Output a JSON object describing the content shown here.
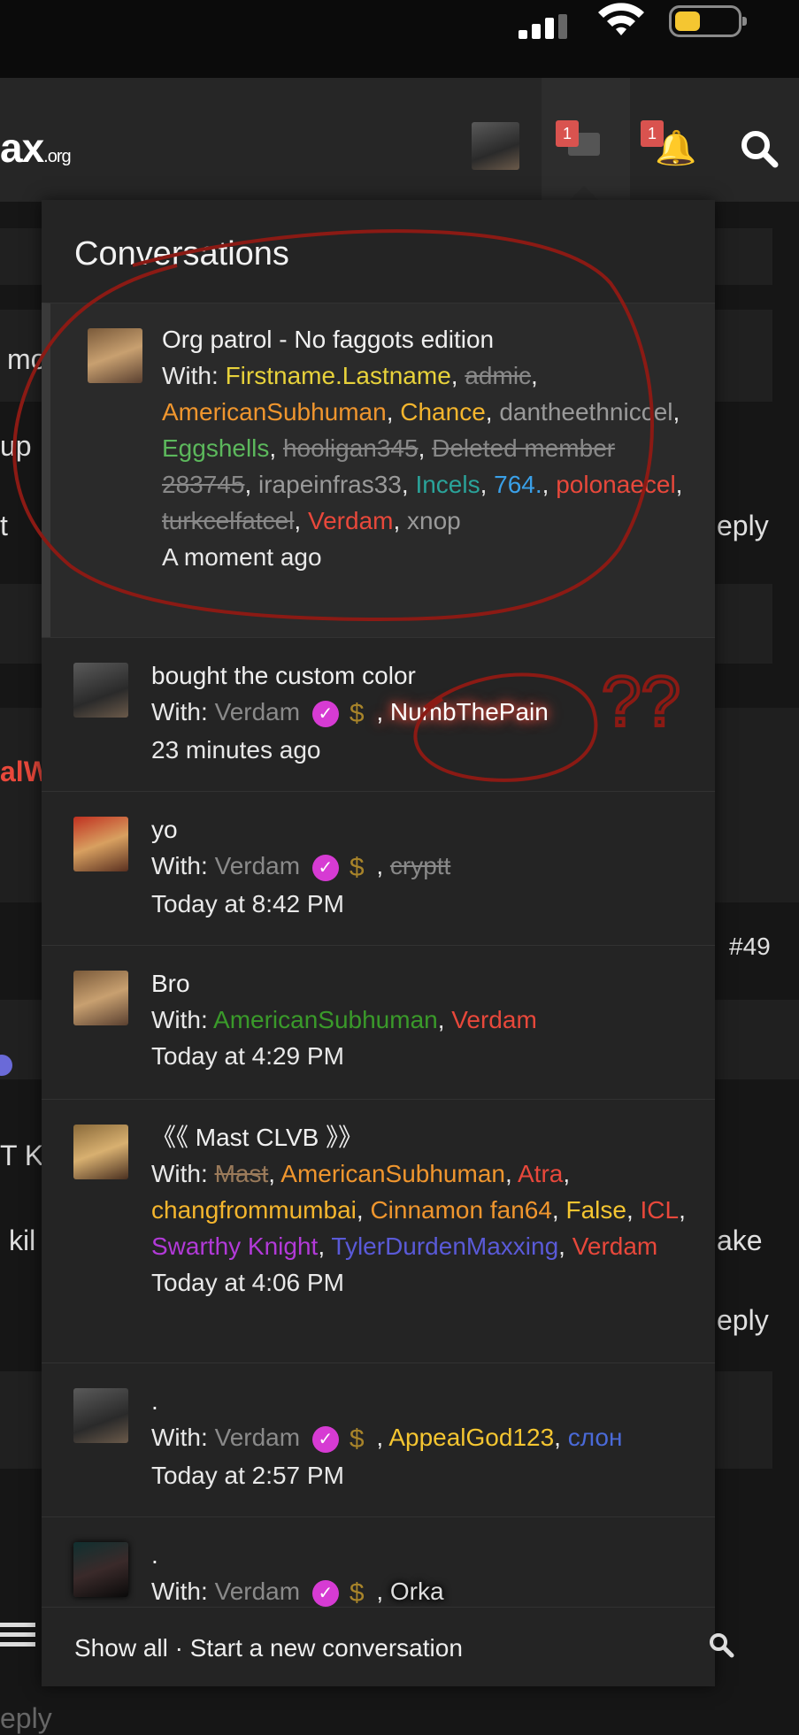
{
  "site": {
    "logo_text": "ax",
    "logo_tld": ".org"
  },
  "nav": {
    "inbox_badge": "1",
    "alerts_badge": "1",
    "icons": [
      "avatar",
      "envelope-icon",
      "bell-icon",
      "search-icon"
    ]
  },
  "background": {
    "snippets": [
      "mo",
      "up",
      "t",
      "eply",
      "alW",
      "#49",
      "T KI",
      "kil",
      "ake",
      "eply",
      "eply"
    ]
  },
  "popup": {
    "title": "Conversations",
    "conversations": [
      {
        "title": "Org patrol - No faggots edition",
        "with_label": "With:",
        "participants": [
          {
            "name": "Firstname.Lastname",
            "color": "#e8d23b"
          },
          {
            "name": "admic",
            "color": "#888888",
            "struck": true
          },
          {
            "name": "AmericanSubhuman",
            "color": "#f0962e"
          },
          {
            "name": "Chance",
            "color": "#f5b62e"
          },
          {
            "name": "dantheethniccel",
            "color": "#9a9a9a"
          },
          {
            "name": "Eggshells",
            "color": "#5cb85c"
          },
          {
            "name": "hooligan345",
            "color": "#888888",
            "struck": true
          },
          {
            "name": "Deleted member 283745",
            "color": "#888888",
            "struck": true
          },
          {
            "name": "irapeinfras33",
            "color": "#9a9a9a"
          },
          {
            "name": "Incels",
            "color": "#2aa39a"
          },
          {
            "name": "764.",
            "color": "#3aa0e8"
          },
          {
            "name": "polonaecel",
            "color": "#e8483b"
          },
          {
            "name": "turkcelfatcel",
            "color": "#888888",
            "struck": true
          },
          {
            "name": "Verdam",
            "color": "#e8483b"
          },
          {
            "name": "xnop",
            "color": "#9a9a9a"
          }
        ],
        "time": "A moment ago"
      },
      {
        "title": "bought the custom color",
        "with_label": "With:",
        "participants_text": [
          "Verdam",
          ", NumbThePain"
        ],
        "time": "23 minutes ago"
      },
      {
        "title": "yo",
        "with_label": "With:",
        "participants_text": [
          "Verdam",
          ", ",
          "cryptt"
        ],
        "time": "Today at 8:42 PM"
      },
      {
        "title": "Bro",
        "with_label": "With:",
        "participants_text": [
          "AmericanSubhuman",
          ", ",
          "Verdam"
        ],
        "time": "Today at 4:29 PM"
      },
      {
        "title": "《《 Mast CLVB 》》",
        "with_label": "With:",
        "participants": [
          {
            "name": "Mast",
            "color": "#9a7a5a",
            "struck": true
          },
          {
            "name": "AmericanSubhuman",
            "color": "#f0962e"
          },
          {
            "name": "Atra",
            "color": "#e8483b"
          },
          {
            "name": "changfrommumbai",
            "color": "#f5b62e"
          },
          {
            "name": "Cinnamon fan64",
            "color": "#f0962e"
          },
          {
            "name": "False",
            "color": "#f5c631"
          },
          {
            "name": "ICL",
            "color": "#e8483b"
          },
          {
            "name": "Swarthy Knight",
            "color": "#b23ad8"
          },
          {
            "name": "TylerDurdenMaxxing",
            "color": "#5a5ad8"
          },
          {
            "name": "Verdam",
            "color": "#e8483b"
          }
        ],
        "time": "Today at 4:06 PM"
      },
      {
        "title": ".",
        "with_label": "With:",
        "participants_text": [
          "Verdam",
          ", ",
          "AppealGod123",
          ", ",
          "слон"
        ],
        "time": "Today at 2:57 PM"
      },
      {
        "title": ".",
        "with_label": "With:",
        "participants_text": [
          "Verdam",
          ", ",
          "Orka"
        ],
        "time": ""
      }
    ],
    "footer": {
      "show_all": "Show all",
      "separator": " · ",
      "start_new": "Start a new conversation"
    }
  },
  "annotation": {
    "text": "??",
    "color": "#8b1a14"
  }
}
